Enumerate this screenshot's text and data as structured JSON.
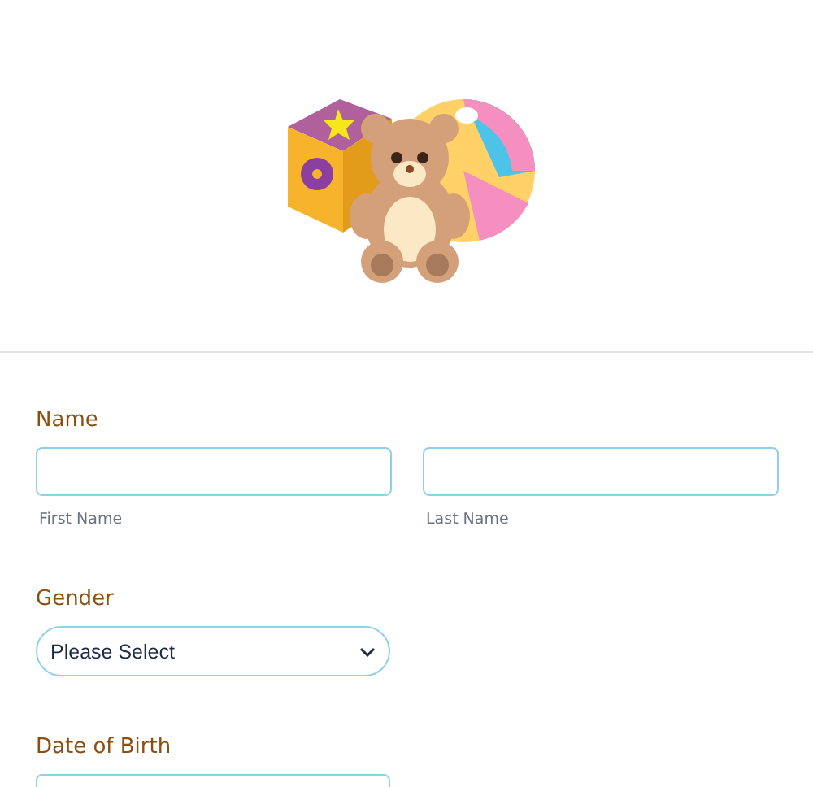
{
  "fields": [
    {
      "kind": "name",
      "label": "Name",
      "sublabels": [
        "First Name",
        "Last Name"
      ]
    },
    {
      "kind": "select",
      "label": "Gender",
      "value": "Please Select"
    },
    {
      "kind": "date",
      "label": "Date of Birth"
    }
  ]
}
